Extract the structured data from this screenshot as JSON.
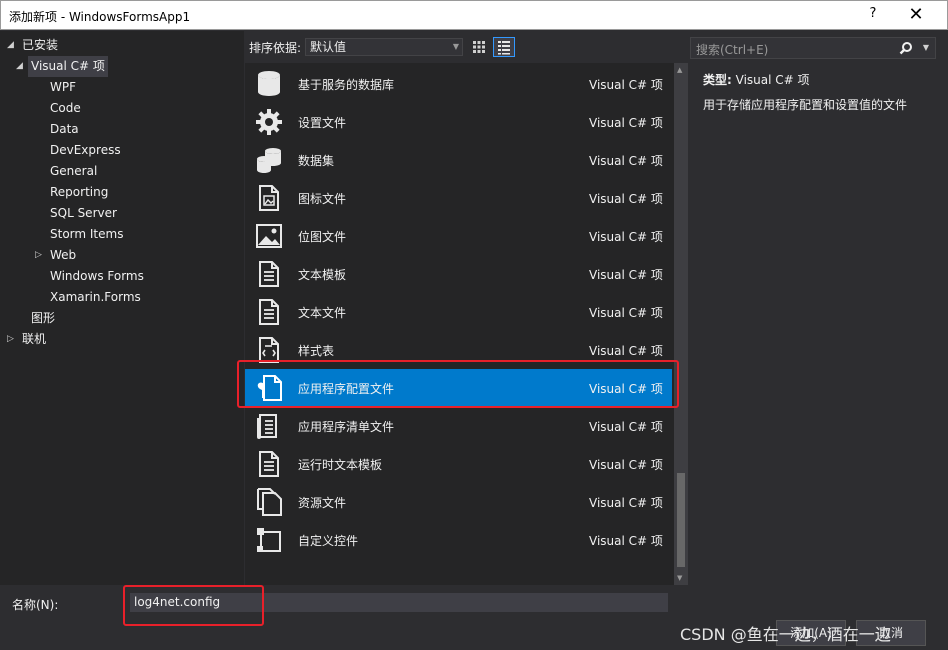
{
  "window": {
    "title": "添加新项 - WindowsFormsApp1",
    "help": "?",
    "close": "✕"
  },
  "tree": [
    {
      "label": "已安装",
      "level": 0,
      "arrow": "◢"
    },
    {
      "label": "Visual C# 项",
      "level": 1,
      "arrow": "◢",
      "selected": true
    },
    {
      "label": "WPF",
      "level": 2
    },
    {
      "label": "Code",
      "level": 2
    },
    {
      "label": "Data",
      "level": 2
    },
    {
      "label": "DevExpress",
      "level": 2
    },
    {
      "label": "General",
      "level": 2
    },
    {
      "label": "Reporting",
      "level": 2
    },
    {
      "label": "SQL Server",
      "level": 2
    },
    {
      "label": "Storm Items",
      "level": 2
    },
    {
      "label": "Web",
      "level": 2,
      "arrow": "▷"
    },
    {
      "label": "Windows Forms",
      "level": 2
    },
    {
      "label": "Xamarin.Forms",
      "level": 2
    },
    {
      "label": "图形",
      "level": 1
    },
    {
      "label": "联机",
      "level": 0,
      "arrow": "▷"
    }
  ],
  "toolbar": {
    "sort_label": "排序依据:",
    "sort_value": "默认值",
    "view_grid_icon": "grid-view-icon",
    "view_list_icon": "list-view-icon"
  },
  "items": [
    {
      "name": "基于服务的数据库",
      "type": "Visual C# 项",
      "icon": "database-icon"
    },
    {
      "name": "设置文件",
      "type": "Visual C# 项",
      "icon": "gear-icon"
    },
    {
      "name": "数据集",
      "type": "Visual C# 项",
      "icon": "dataset-icon"
    },
    {
      "name": "图标文件",
      "type": "Visual C# 项",
      "icon": "icon-file-icon"
    },
    {
      "name": "位图文件",
      "type": "Visual C# 项",
      "icon": "bitmap-icon"
    },
    {
      "name": "文本模板",
      "type": "Visual C# 项",
      "icon": "text-template-icon"
    },
    {
      "name": "文本文件",
      "type": "Visual C# 项",
      "icon": "text-file-icon"
    },
    {
      "name": "样式表",
      "type": "Visual C# 项",
      "icon": "stylesheet-icon"
    },
    {
      "name": "应用程序配置文件",
      "type": "Visual C# 项",
      "icon": "config-file-icon",
      "selected": true
    },
    {
      "name": "应用程序清单文件",
      "type": "Visual C# 项",
      "icon": "manifest-icon"
    },
    {
      "name": "运行时文本模板",
      "type": "Visual C# 项",
      "icon": "runtime-template-icon"
    },
    {
      "name": "资源文件",
      "type": "Visual C# 项",
      "icon": "resource-file-icon"
    },
    {
      "name": "自定义控件",
      "type": "Visual C# 项",
      "icon": "custom-control-icon"
    }
  ],
  "search": {
    "placeholder": "搜索(Ctrl+E)"
  },
  "details": {
    "type_label": "类型:",
    "type_value": "Visual C# 项",
    "description": "用于存储应用程序配置和设置值的文件"
  },
  "name_field": {
    "label": "名称(N):",
    "value": "log4net.config"
  },
  "buttons": {
    "add": "添加(A)",
    "cancel": "取消"
  },
  "watermark": "CSDN @鱼在一边，酒在一边",
  "colors": {
    "selection": "#007acc",
    "highlight": "#e8202a"
  }
}
